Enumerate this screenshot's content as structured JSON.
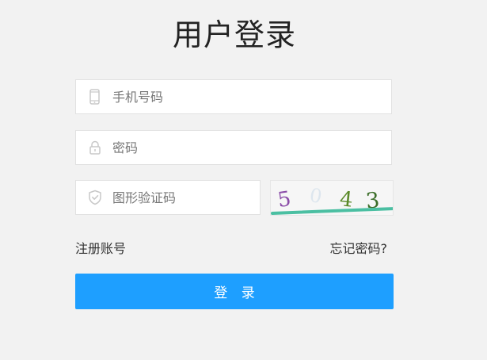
{
  "page": {
    "title": "用户登录"
  },
  "form": {
    "phone": {
      "placeholder": "手机号码",
      "value": "",
      "icon": "phone-icon"
    },
    "password": {
      "placeholder": "密码",
      "value": "",
      "icon": "lock-icon"
    },
    "captcha": {
      "placeholder": "图形验证码",
      "value": "",
      "icon": "shield-icon",
      "image_text": "5 0 4 3"
    },
    "register_label": "注册账号",
    "forgot_label": "忘记密码?",
    "login_label": "登 录"
  },
  "colors": {
    "background": "#f2f2f2",
    "primary": "#1e9fff",
    "input_border": "#e2e2e2",
    "icon_gray": "#c8c8c8"
  }
}
